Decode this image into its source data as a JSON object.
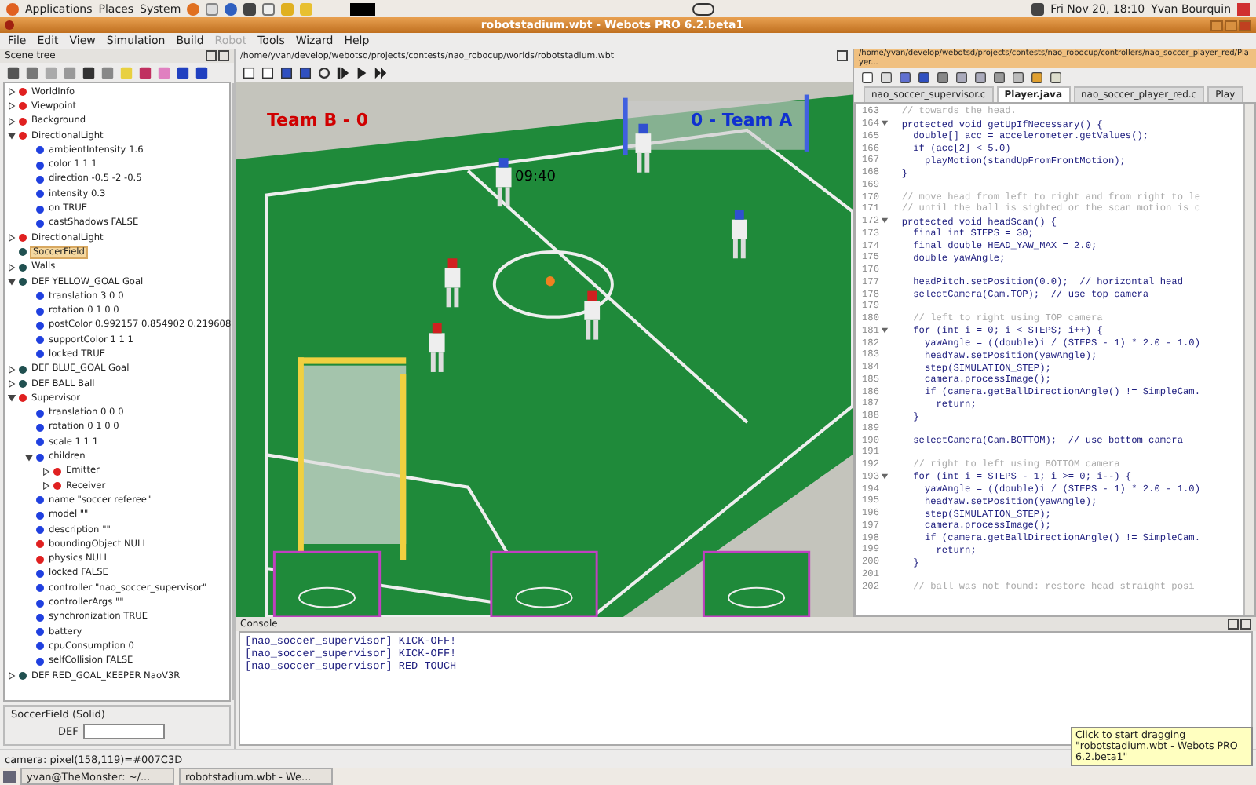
{
  "top_panel": {
    "menus": [
      "Applications",
      "Places",
      "System"
    ],
    "clock": "Fri Nov 20, 18:10",
    "user": "Yvan Bourquin"
  },
  "window": {
    "title": "robotstadium.wbt - Webots PRO 6.2.beta1"
  },
  "menu": [
    {
      "label": "File",
      "disabled": false
    },
    {
      "label": "Edit",
      "disabled": false
    },
    {
      "label": "View",
      "disabled": false
    },
    {
      "label": "Simulation",
      "disabled": false
    },
    {
      "label": "Build",
      "disabled": false
    },
    {
      "label": "Robot",
      "disabled": true
    },
    {
      "label": "Tools",
      "disabled": false
    },
    {
      "label": "Wizard",
      "disabled": false
    },
    {
      "label": "Help",
      "disabled": false
    }
  ],
  "scene_tree": {
    "title": "Scene tree",
    "items": [
      {
        "label": "WorldInfo",
        "color": "#e02020",
        "expanded": false,
        "selected": false
      },
      {
        "label": "Viewpoint",
        "color": "#e02020",
        "expanded": false,
        "selected": false
      },
      {
        "label": "Background",
        "color": "#e02020",
        "expanded": false,
        "selected": false
      },
      {
        "label": "DirectionalLight",
        "color": "#e02020",
        "expanded": true,
        "selected": false,
        "children": [
          {
            "label": "ambientIntensity 1.6",
            "color": "#2040e0",
            "selected": false
          },
          {
            "label": "color 1 1 1",
            "color": "#2040e0",
            "selected": false
          },
          {
            "label": "direction -0.5 -2 -0.5",
            "color": "#2040e0",
            "selected": false
          },
          {
            "label": "intensity 0.3",
            "color": "#2040e0",
            "selected": false
          },
          {
            "label": "on TRUE",
            "color": "#2040e0",
            "selected": false
          },
          {
            "label": "castShadows FALSE",
            "color": "#2040e0",
            "selected": false
          }
        ]
      },
      {
        "label": "DirectionalLight",
        "color": "#e02020",
        "expanded": false,
        "selected": false
      },
      {
        "label": "SoccerField",
        "color": "#205050",
        "selected": true
      },
      {
        "label": "Walls",
        "color": "#205050",
        "expanded": false,
        "selected": false
      },
      {
        "label": "DEF YELLOW_GOAL Goal",
        "color": "#205050",
        "expanded": true,
        "selected": false,
        "children": [
          {
            "label": "translation 3 0 0",
            "color": "#2040e0",
            "selected": false
          },
          {
            "label": "rotation 0 1 0 0",
            "color": "#2040e0",
            "selected": false
          },
          {
            "label": "postColor 0.992157 0.854902 0.219608",
            "color": "#2040e0",
            "selected": false
          },
          {
            "label": "supportColor 1 1 1",
            "color": "#2040e0",
            "selected": false
          },
          {
            "label": "locked TRUE",
            "color": "#2040e0",
            "selected": false
          }
        ]
      },
      {
        "label": "DEF BLUE_GOAL Goal",
        "color": "#205050",
        "expanded": false,
        "selected": false
      },
      {
        "label": "DEF BALL Ball",
        "color": "#205050",
        "expanded": false,
        "selected": false
      },
      {
        "label": "Supervisor",
        "color": "#e02020",
        "expanded": true,
        "selected": false,
        "children": [
          {
            "label": "translation 0 0 0",
            "color": "#2040e0",
            "selected": false
          },
          {
            "label": "rotation 0 1 0 0",
            "color": "#2040e0",
            "selected": false
          },
          {
            "label": "scale 1 1 1",
            "color": "#2040e0",
            "selected": false
          },
          {
            "label": "children",
            "color": "#2040e0",
            "expanded": true,
            "selected": false,
            "children": [
              {
                "label": "Emitter",
                "color": "#e02020",
                "expanded": false,
                "selected": false
              },
              {
                "label": "Receiver",
                "color": "#e02020",
                "expanded": false,
                "selected": false
              }
            ]
          },
          {
            "label": "name \"soccer referee\"",
            "color": "#2040e0",
            "selected": false
          },
          {
            "label": "model \"\"",
            "color": "#2040e0",
            "selected": false
          },
          {
            "label": "description \"\"",
            "color": "#2040e0",
            "selected": false
          },
          {
            "label": "boundingObject NULL",
            "color": "#e02020",
            "selected": false
          },
          {
            "label": "physics NULL",
            "color": "#e02020",
            "selected": false
          },
          {
            "label": "locked FALSE",
            "color": "#2040e0",
            "selected": false
          },
          {
            "label": "controller \"nao_soccer_supervisor\"",
            "color": "#2040e0",
            "selected": false
          },
          {
            "label": "controllerArgs \"\"",
            "color": "#2040e0",
            "selected": false
          },
          {
            "label": "synchronization TRUE",
            "color": "#2040e0",
            "selected": false
          },
          {
            "label": "battery",
            "color": "#2040e0",
            "selected": false
          },
          {
            "label": "cpuConsumption 0",
            "color": "#2040e0",
            "selected": false
          },
          {
            "label": "selfCollision FALSE",
            "color": "#2040e0",
            "selected": false
          }
        ]
      },
      {
        "label": "DEF RED_GOAL_KEEPER NaoV3R",
        "color": "#205050",
        "expanded": false,
        "selected": false
      }
    ],
    "node_group": "SoccerField (Solid)",
    "def_label": "DEF"
  },
  "view3d": {
    "path": "/home/yvan/develop/webotsd/projects/contests/nao_robocup/worlds/robotstadium.wbt",
    "team_left": "Team B - 0",
    "team_right": "0 - Team A",
    "time": "09:40"
  },
  "editor": {
    "path": "/home/yvan/develop/webotsd/projects/contests/nao_robocup/controllers/nao_soccer_player_red/Player...",
    "tabs": [
      {
        "label": "nao_soccer_supervisor.c",
        "selected": false
      },
      {
        "label": "Player.java",
        "selected": true
      },
      {
        "label": "nao_soccer_player_red.c",
        "selected": false
      },
      {
        "label": "Play",
        "selected": false
      }
    ],
    "lines": [
      {
        "n": "163",
        "text": "  // towards the head.",
        "kind": "comment",
        "fold": false
      },
      {
        "n": "164",
        "text": "  protected void getUpIfNecessary() {",
        "kind": "code",
        "fold": true
      },
      {
        "n": "165",
        "text": "    double[] acc = accelerometer.getValues();",
        "kind": "code",
        "fold": false
      },
      {
        "n": "166",
        "text": "    if (acc[2] < 5.0)",
        "kind": "code",
        "fold": false
      },
      {
        "n": "167",
        "text": "      playMotion(standUpFromFrontMotion);",
        "kind": "code",
        "fold": false
      },
      {
        "n": "168",
        "text": "  }",
        "kind": "code",
        "fold": false
      },
      {
        "n": "169",
        "kind": "blank",
        "fold": false
      },
      {
        "n": "170",
        "text": "  // move head from left to right and from right to le",
        "kind": "comment",
        "fold": false
      },
      {
        "n": "171",
        "text": "  // until the ball is sighted or the scan motion is c",
        "kind": "comment",
        "fold": false
      },
      {
        "n": "172",
        "text": "  protected void headScan() {",
        "kind": "code",
        "fold": true
      },
      {
        "n": "173",
        "text": "    final int STEPS = 30;",
        "kind": "code",
        "fold": false
      },
      {
        "n": "174",
        "text": "    final double HEAD_YAW_MAX = 2.0;",
        "kind": "code",
        "fold": false
      },
      {
        "n": "175",
        "text": "    double yawAngle;",
        "kind": "code",
        "fold": false
      },
      {
        "n": "176",
        "kind": "blank",
        "fold": false
      },
      {
        "n": "177",
        "text": "    headPitch.setPosition(0.0);  // horizontal head",
        "kind": "code",
        "fold": false
      },
      {
        "n": "178",
        "text": "    selectCamera(Cam.TOP);  // use top camera",
        "kind": "code",
        "fold": false
      },
      {
        "n": "179",
        "kind": "blank",
        "fold": false
      },
      {
        "n": "180",
        "text": "    // left to right using TOP camera",
        "kind": "comment",
        "fold": false
      },
      {
        "n": "181",
        "text": "    for (int i = 0; i < STEPS; i++) {",
        "kind": "code",
        "fold": true
      },
      {
        "n": "182",
        "text": "      yawAngle = ((double)i / (STEPS - 1) * 2.0 - 1.0)",
        "kind": "code",
        "fold": false
      },
      {
        "n": "183",
        "text": "      headYaw.setPosition(yawAngle);",
        "kind": "code",
        "fold": false
      },
      {
        "n": "184",
        "text": "      step(SIMULATION_STEP);",
        "kind": "code",
        "fold": false
      },
      {
        "n": "185",
        "text": "      camera.processImage();",
        "kind": "code",
        "fold": false
      },
      {
        "n": "186",
        "text": "      if (camera.getBallDirectionAngle() != SimpleCam.",
        "kind": "code",
        "fold": false
      },
      {
        "n": "187",
        "text": "        return;",
        "kind": "code",
        "fold": false
      },
      {
        "n": "188",
        "text": "    }",
        "kind": "code",
        "fold": false
      },
      {
        "n": "189",
        "kind": "blank",
        "fold": false
      },
      {
        "n": "190",
        "text": "    selectCamera(Cam.BOTTOM);  // use bottom camera",
        "kind": "code",
        "fold": false
      },
      {
        "n": "191",
        "kind": "blank",
        "fold": false
      },
      {
        "n": "192",
        "text": "    // right to left using BOTTOM camera",
        "kind": "comment",
        "fold": false
      },
      {
        "n": "193",
        "text": "    for (int i = STEPS - 1; i >= 0; i--) {",
        "kind": "code",
        "fold": true
      },
      {
        "n": "194",
        "text": "      yawAngle = ((double)i / (STEPS - 1) * 2.0 - 1.0)",
        "kind": "code",
        "fold": false
      },
      {
        "n": "195",
        "text": "      headYaw.setPosition(yawAngle);",
        "kind": "code",
        "fold": false
      },
      {
        "n": "196",
        "text": "      step(SIMULATION_STEP);",
        "kind": "code",
        "fold": false
      },
      {
        "n": "197",
        "text": "      camera.processImage();",
        "kind": "code",
        "fold": false
      },
      {
        "n": "198",
        "text": "      if (camera.getBallDirectionAngle() != SimpleCam.",
        "kind": "code",
        "fold": false
      },
      {
        "n": "199",
        "text": "        return;",
        "kind": "code",
        "fold": false
      },
      {
        "n": "200",
        "text": "    }",
        "kind": "code",
        "fold": false
      },
      {
        "n": "201",
        "kind": "blank",
        "fold": false
      },
      {
        "n": "202",
        "text": "    // ball was not found: restore head straight posi",
        "kind": "comment",
        "fold": false
      }
    ]
  },
  "console": {
    "title": "Console",
    "lines": [
      "[nao_soccer_supervisor] KICK-OFF!",
      "[nao_soccer_supervisor] KICK-OFF!",
      "[nao_soccer_supervisor] RED TOUCH"
    ]
  },
  "status_bar": "camera: pixel(158,119)=#007C3D",
  "taskbar": [
    "yvan@TheMonster: ~/...",
    "robotstadium.wbt - We..."
  ],
  "tooltip": "Click to start dragging \"robotstadium.wbt - Webots PRO 6.2.beta1\""
}
